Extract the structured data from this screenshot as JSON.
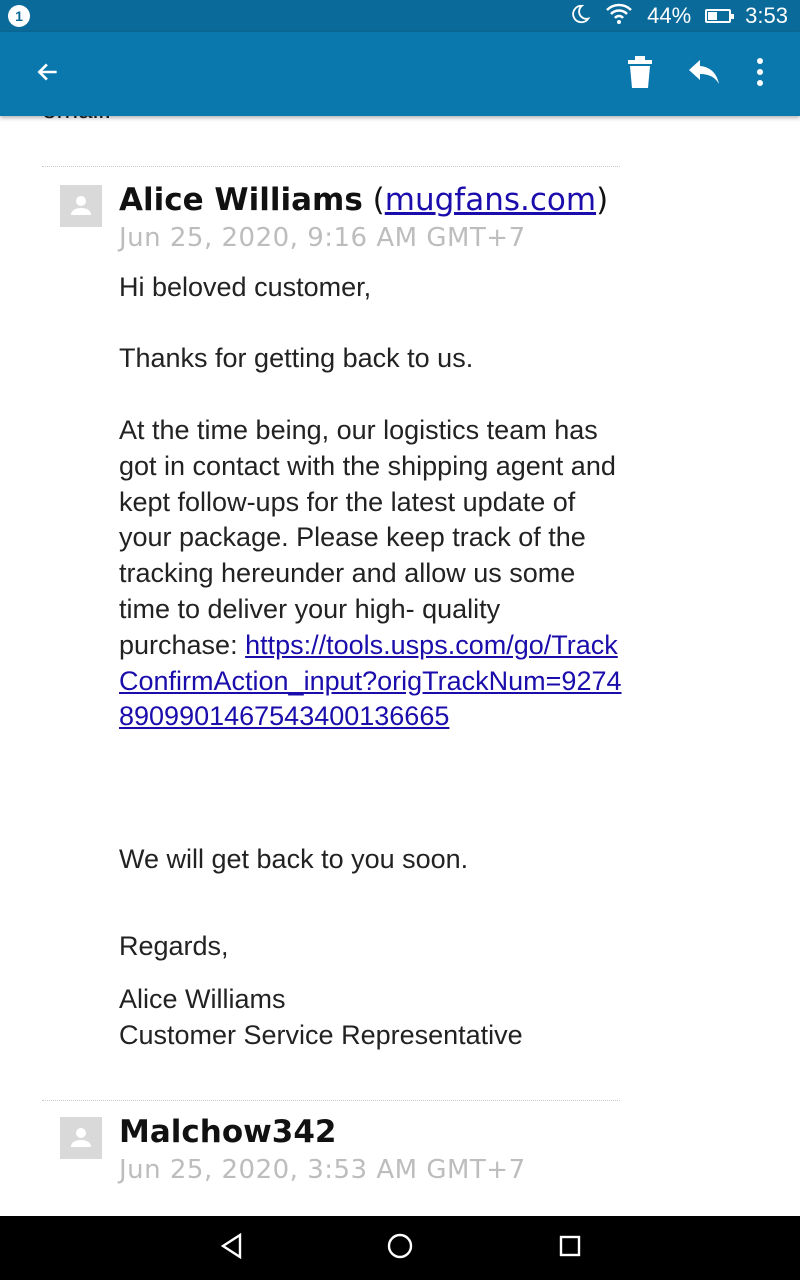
{
  "status_bar": {
    "notification_count": "1",
    "battery_percent": "44%",
    "battery_level": 0.44,
    "time": "3:53",
    "icons": [
      "moon-icon",
      "wifi-icon",
      "battery-icon"
    ]
  },
  "toolbar": {
    "back_icon": "back-arrow-icon",
    "delete_icon": "trash-icon",
    "reply_icon": "reply-icon",
    "overflow_icon": "more-vert-icon"
  },
  "previous_text": "email.",
  "messages": [
    {
      "sender_name": "Alice Williams",
      "sender_domain_open": "(",
      "sender_domain": "mugfans.com",
      "sender_domain_close": ")",
      "date": "Jun 25, 2020, 9:16 AM GMT+7",
      "greeting": "Hi beloved customer,",
      "thanks": "Thanks for getting back to us.",
      "body": "At the time being, our logistics team has got in contact with the shipping agent and kept follow-ups for the latest update of your package. Please keep track of the tracking hereunder and allow us some time to deliver your high- quality purchase:",
      "tracking_link": "https://tools.usps.com/go/TrackConfirmAction_input?origTrackNum=92748909901467543400136665",
      "closing": "We will get back to you soon.",
      "regards": "Regards,",
      "signature_name": "Alice Williams",
      "signature_title": "Customer Service Representative"
    },
    {
      "sender_name": "Malchow342",
      "date": "Jun 25, 2020, 3:53 AM GMT+7"
    }
  ],
  "colors": {
    "status_bar": "#0a6a99",
    "app_bar": "#0b78ad",
    "link": "#1a0dab",
    "date_text": "#bdbdbd"
  }
}
